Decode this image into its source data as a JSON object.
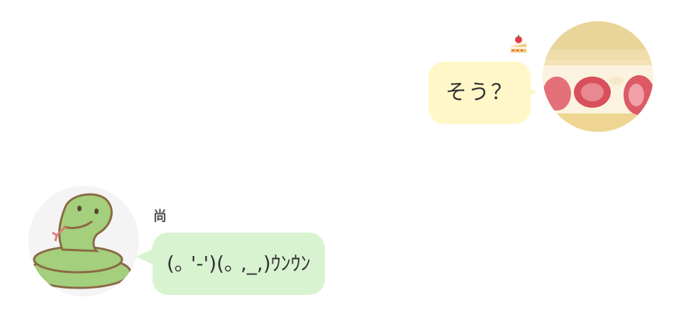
{
  "messages": [
    {
      "side": "right",
      "text": "そう？",
      "avatar": "strawberry-sandwich-avatar",
      "badge_icon": "strawberry-shortcake-icon",
      "bubble_color": "#fff7c8"
    },
    {
      "side": "left",
      "sender": "尚",
      "text": "(｡ '-')(｡ ,_,)ｳﾝｳﾝ",
      "avatar": "green-snake-avatar",
      "bubble_color": "#d8f3d0"
    }
  ]
}
